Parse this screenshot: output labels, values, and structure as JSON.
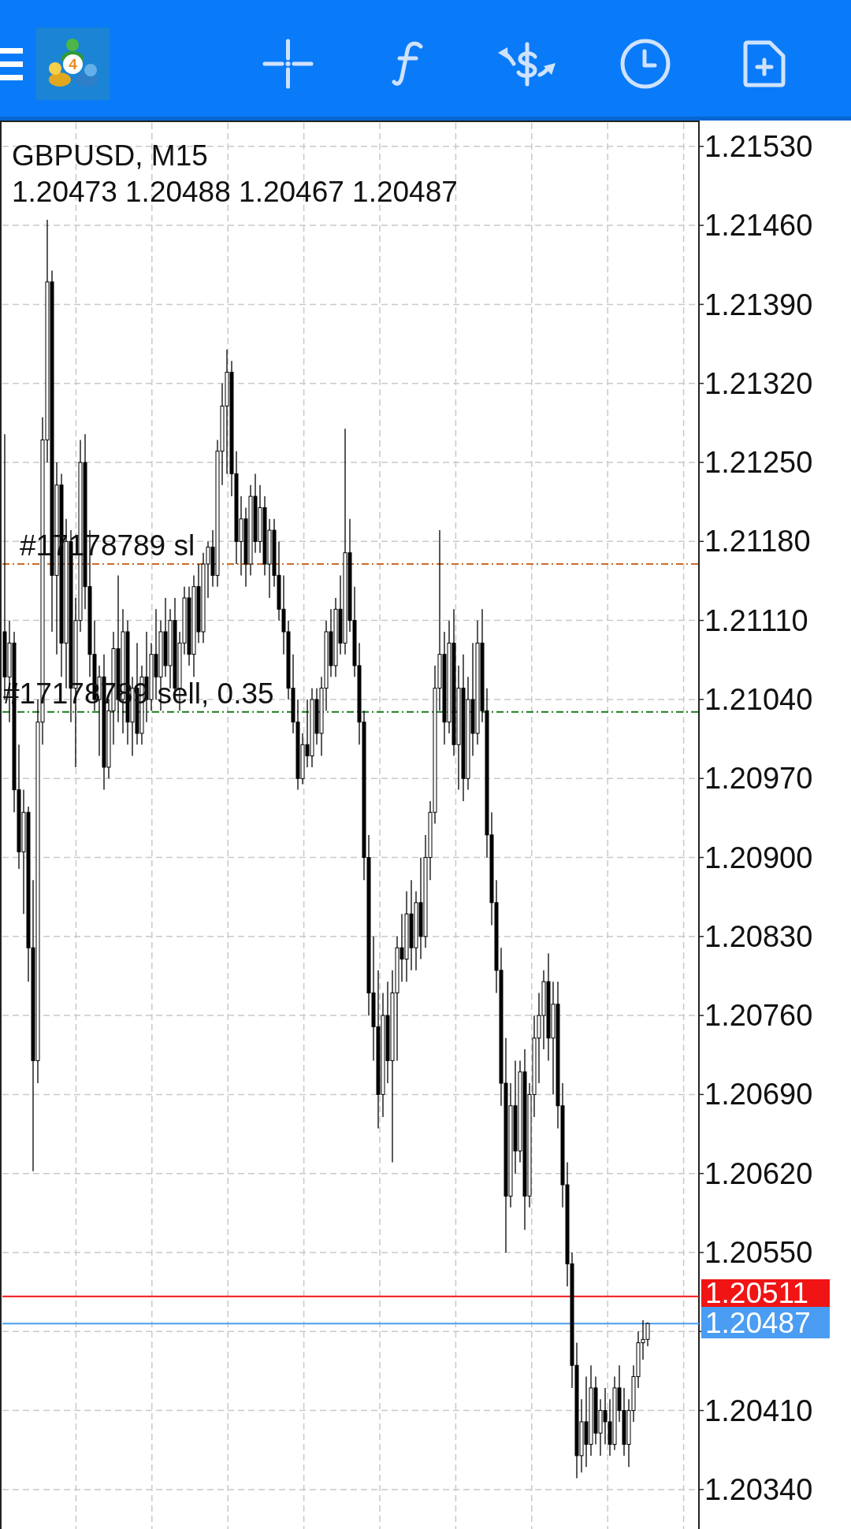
{
  "top_bar": {
    "logo": {
      "badge": "4"
    }
  },
  "chart": {
    "symbol": "GBPUSD, M15",
    "ohlc": "1.20473 1.20488 1.20467 1.20487",
    "chart_data": {
      "type": "candlestick",
      "grid": true,
      "ylim": [
        1.20305,
        1.21553
      ],
      "yticks": [
        {
          "value": 1.2153,
          "label": "1.21530"
        },
        {
          "value": 1.2146,
          "label": "1.21460"
        },
        {
          "value": 1.2139,
          "label": "1.21390"
        },
        {
          "value": 1.2132,
          "label": "1.21320"
        },
        {
          "value": 1.2125,
          "label": "1.21250"
        },
        {
          "value": 1.2118,
          "label": "1.21180"
        },
        {
          "value": 1.2111,
          "label": "1.21110"
        },
        {
          "value": 1.2104,
          "label": "1.21040"
        },
        {
          "value": 1.2097,
          "label": "1.20970"
        },
        {
          "value": 1.209,
          "label": "1.20900"
        },
        {
          "value": 1.2083,
          "label": "1.20830"
        },
        {
          "value": 1.2076,
          "label": "1.20760"
        },
        {
          "value": 1.2069,
          "label": "1.20690"
        },
        {
          "value": 1.2062,
          "label": "1.20620"
        },
        {
          "value": 1.2055,
          "label": "1.20550"
        },
        {
          "value": 1.2041,
          "label": "1.20410"
        },
        {
          "value": 1.2034,
          "label": "1.20340"
        }
      ],
      "ref_lines": [
        {
          "axis": "y",
          "value": 1.2116,
          "label": "#17178789 sl",
          "color": "#cd6a28"
        },
        {
          "axis": "y",
          "value": 1.21029,
          "label": "#17178789 sell, 0.35",
          "color": "#1c7a1c"
        },
        {
          "axis": "y",
          "value": 1.20511,
          "label": "1.20511",
          "color": "#f01414"
        },
        {
          "axis": "y",
          "value": 1.20487,
          "label": "1.20487",
          "color": "#4a9df2"
        }
      ],
      "ohlc": [
        [
          1.211,
          1.21275,
          1.2104,
          1.2106
        ],
        [
          1.2106,
          1.2111,
          1.2102,
          1.2109
        ],
        [
          1.2109,
          1.211,
          1.2094,
          1.2096
        ],
        [
          1.2096,
          1.21,
          1.2089,
          1.20905
        ],
        [
          1.20905,
          1.2096,
          1.2085,
          1.2094
        ],
        [
          1.2094,
          1.20945,
          1.2079,
          1.2082
        ],
        [
          1.2082,
          1.2088,
          1.20622,
          1.2072
        ],
        [
          1.2072,
          1.2104,
          1.207,
          1.2102
        ],
        [
          1.2102,
          1.2129,
          1.21,
          1.2127
        ],
        [
          1.2127,
          1.21465,
          1.2125,
          1.2141
        ],
        [
          1.2141,
          1.2142,
          1.211,
          1.2115
        ],
        [
          1.2115,
          1.2125,
          1.2108,
          1.2123
        ],
        [
          1.2123,
          1.2124,
          1.2106,
          1.2109
        ],
        [
          1.2109,
          1.212,
          1.2105,
          1.2118
        ],
        [
          1.2118,
          1.2119,
          1.2102,
          1.2105
        ],
        [
          1.2105,
          1.2113,
          1.2098,
          1.2111
        ],
        [
          1.2111,
          1.2127,
          1.211,
          1.2125
        ],
        [
          1.2125,
          1.21275,
          1.2112,
          1.2114
        ],
        [
          1.2114,
          1.2119,
          1.2106,
          1.2108
        ],
        [
          1.2108,
          1.2111,
          1.2103,
          1.2104
        ],
        [
          1.2104,
          1.2107,
          1.2099,
          1.2106
        ],
        [
          1.2106,
          1.2108,
          1.2096,
          1.2098
        ],
        [
          1.2098,
          1.2104,
          1.2097,
          1.2103
        ],
        [
          1.2103,
          1.211,
          1.21,
          1.21085
        ],
        [
          1.21085,
          1.2115,
          1.2102,
          1.2104
        ],
        [
          1.2104,
          1.2112,
          1.2101,
          1.211
        ],
        [
          1.211,
          1.2111,
          1.21,
          1.2102
        ],
        [
          1.2102,
          1.2106,
          1.2099,
          1.2105
        ],
        [
          1.2105,
          1.2109,
          1.21,
          1.2101
        ],
        [
          1.2101,
          1.2107,
          1.21,
          1.2106
        ],
        [
          1.2106,
          1.211,
          1.2102,
          1.2104
        ],
        [
          1.2104,
          1.2109,
          1.2103,
          1.2108
        ],
        [
          1.2108,
          1.2112,
          1.2104,
          1.2106
        ],
        [
          1.2106,
          1.2111,
          1.2103,
          1.211
        ],
        [
          1.211,
          1.2113,
          1.2106,
          1.2107
        ],
        [
          1.2107,
          1.2112,
          1.2105,
          1.2111
        ],
        [
          1.2111,
          1.2113,
          1.2104,
          1.2105
        ],
        [
          1.2105,
          1.211,
          1.2103,
          1.2109
        ],
        [
          1.2109,
          1.2114,
          1.2108,
          1.2113
        ],
        [
          1.2113,
          1.2114,
          1.2107,
          1.2108
        ],
        [
          1.2108,
          1.2115,
          1.2106,
          1.2114
        ],
        [
          1.2114,
          1.2116,
          1.2109,
          1.211
        ],
        [
          1.211,
          1.2117,
          1.2109,
          1.2116
        ],
        [
          1.2116,
          1.2118,
          1.2113,
          1.21175
        ],
        [
          1.21175,
          1.2119,
          1.2114,
          1.2115
        ],
        [
          1.2115,
          1.2127,
          1.2114,
          1.2126
        ],
        [
          1.2126,
          1.2132,
          1.2123,
          1.213
        ],
        [
          1.213,
          1.2135,
          1.2124,
          1.2133
        ],
        [
          1.2133,
          1.2134,
          1.2122,
          1.2124
        ],
        [
          1.2124,
          1.2126,
          1.2116,
          1.2118
        ],
        [
          1.2118,
          1.2122,
          1.2115,
          1.212
        ],
        [
          1.212,
          1.2121,
          1.2114,
          1.2116
        ],
        [
          1.2116,
          1.2123,
          1.2115,
          1.2122
        ],
        [
          1.2122,
          1.2124,
          1.2117,
          1.2118
        ],
        [
          1.2118,
          1.2123,
          1.2117,
          1.2121
        ],
        [
          1.2121,
          1.2122,
          1.2115,
          1.2116
        ],
        [
          1.2116,
          1.212,
          1.2113,
          1.2119
        ],
        [
          1.2119,
          1.212,
          1.2114,
          1.2115
        ],
        [
          1.2115,
          1.2118,
          1.2111,
          1.2112
        ],
        [
          1.2112,
          1.2115,
          1.2108,
          1.211
        ],
        [
          1.211,
          1.2111,
          1.2104,
          1.2105
        ],
        [
          1.2105,
          1.2108,
          1.2101,
          1.2102
        ],
        [
          1.2102,
          1.2104,
          1.2096,
          1.2097
        ],
        [
          1.2097,
          1.2101,
          1.20965,
          1.21
        ],
        [
          1.21,
          1.2104,
          1.2098,
          1.2099
        ],
        [
          1.2099,
          1.2105,
          1.2098,
          1.2104
        ],
        [
          1.2104,
          1.2105,
          1.21,
          1.2101
        ],
        [
          1.2101,
          1.2106,
          1.2099,
          1.2105
        ],
        [
          1.2105,
          1.2111,
          1.2103,
          1.211
        ],
        [
          1.211,
          1.2112,
          1.2106,
          1.2107
        ],
        [
          1.2107,
          1.2113,
          1.2106,
          1.2112
        ],
        [
          1.2112,
          1.2115,
          1.2108,
          1.2109
        ],
        [
          1.2109,
          1.2128,
          1.2108,
          1.2117
        ],
        [
          1.2117,
          1.212,
          1.211,
          1.2111
        ],
        [
          1.2111,
          1.2114,
          1.2106,
          1.2107
        ],
        [
          1.2107,
          1.2109,
          1.21,
          1.2102
        ],
        [
          1.2102,
          1.2103,
          1.2088,
          1.209
        ],
        [
          1.209,
          1.2092,
          1.2076,
          1.2078
        ],
        [
          1.2078,
          1.2083,
          1.2072,
          1.2075
        ],
        [
          1.2075,
          1.208,
          1.2066,
          1.2069
        ],
        [
          1.2069,
          1.2078,
          1.2067,
          1.2076
        ],
        [
          1.2076,
          1.2079,
          1.207,
          1.2072
        ],
        [
          1.2072,
          1.208,
          1.2063,
          1.2078
        ],
        [
          1.2078,
          1.2083,
          1.2072,
          1.2082
        ],
        [
          1.2082,
          1.2085,
          1.2079,
          1.2081
        ],
        [
          1.2081,
          1.2087,
          1.2079,
          1.2085
        ],
        [
          1.2085,
          1.2088,
          1.208,
          1.2082
        ],
        [
          1.2082,
          1.2087,
          1.208,
          1.2086
        ],
        [
          1.2086,
          1.209,
          1.2081,
          1.2083
        ],
        [
          1.2083,
          1.2092,
          1.2082,
          1.209
        ],
        [
          1.209,
          1.2095,
          1.2088,
          1.2094
        ],
        [
          1.2094,
          1.2107,
          1.2093,
          1.2105
        ],
        [
          1.2105,
          1.2119,
          1.2103,
          1.2108
        ],
        [
          1.2108,
          1.211,
          1.21,
          1.2102
        ],
        [
          1.2102,
          1.2111,
          1.2101,
          1.2109
        ],
        [
          1.2109,
          1.2112,
          1.2099,
          1.21
        ],
        [
          1.21,
          1.2107,
          1.2096,
          1.2105
        ],
        [
          1.2105,
          1.2108,
          1.2095,
          1.2097
        ],
        [
          1.2097,
          1.2106,
          1.2096,
          1.2104
        ],
        [
          1.2104,
          1.2109,
          1.2099,
          1.2101
        ],
        [
          1.2101,
          1.2111,
          1.21,
          1.2109
        ],
        [
          1.2109,
          1.2112,
          1.2102,
          1.2103
        ],
        [
          1.2103,
          1.2105,
          1.209,
          1.2092
        ],
        [
          1.2092,
          1.2094,
          1.2084,
          1.2086
        ],
        [
          1.2086,
          1.2088,
          1.2078,
          1.208
        ],
        [
          1.208,
          1.2082,
          1.2068,
          1.207
        ],
        [
          1.207,
          1.2074,
          1.2055,
          1.206
        ],
        [
          1.206,
          1.207,
          1.2059,
          1.2068
        ],
        [
          1.2068,
          1.2072,
          1.2062,
          1.2064
        ],
        [
          1.2064,
          1.2072,
          1.2063,
          1.2071
        ],
        [
          1.2071,
          1.2073,
          1.2057,
          1.206
        ],
        [
          1.206,
          1.207,
          1.2059,
          1.2069
        ],
        [
          1.2069,
          1.2076,
          1.2067,
          1.2074
        ],
        [
          1.2074,
          1.2078,
          1.207,
          1.2076
        ],
        [
          1.2076,
          1.208,
          1.2073,
          1.2079
        ],
        [
          1.2079,
          1.20815,
          1.2072,
          1.2074
        ],
        [
          1.2074,
          1.2079,
          1.2069,
          1.2077
        ],
        [
          1.2077,
          1.2079,
          1.2066,
          1.2068
        ],
        [
          1.2068,
          1.207,
          1.2059,
          1.2061
        ],
        [
          1.2061,
          1.2063,
          1.2052,
          1.2054
        ],
        [
          1.2054,
          1.2055,
          1.2043,
          1.2045
        ],
        [
          1.2045,
          1.2047,
          1.2035,
          1.2037
        ],
        [
          1.2037,
          1.2042,
          1.20355,
          1.204
        ],
        [
          1.204,
          1.2044,
          1.2036,
          1.2038
        ],
        [
          1.2038,
          1.2045,
          1.2037,
          1.2043
        ],
        [
          1.2043,
          1.2044,
          1.2038,
          1.2039
        ],
        [
          1.2039,
          1.2042,
          1.2037,
          1.2041
        ],
        [
          1.2041,
          1.2043,
          1.2038,
          1.204
        ],
        [
          1.204,
          1.2042,
          1.2037,
          1.2038
        ],
        [
          1.2038,
          1.2044,
          1.20375,
          1.2043
        ],
        [
          1.2043,
          1.2045,
          1.204,
          1.2041
        ],
        [
          1.2041,
          1.2043,
          1.2037,
          1.2038
        ],
        [
          1.2038,
          1.2042,
          1.2036,
          1.2041
        ],
        [
          1.2041,
          1.2045,
          1.204,
          1.2044
        ],
        [
          1.2044,
          1.2048,
          1.2043,
          1.2047
        ],
        [
          1.2047,
          1.2049,
          1.20455,
          1.20473
        ],
        [
          1.20473,
          1.20488,
          1.20467,
          1.20487
        ]
      ]
    }
  }
}
